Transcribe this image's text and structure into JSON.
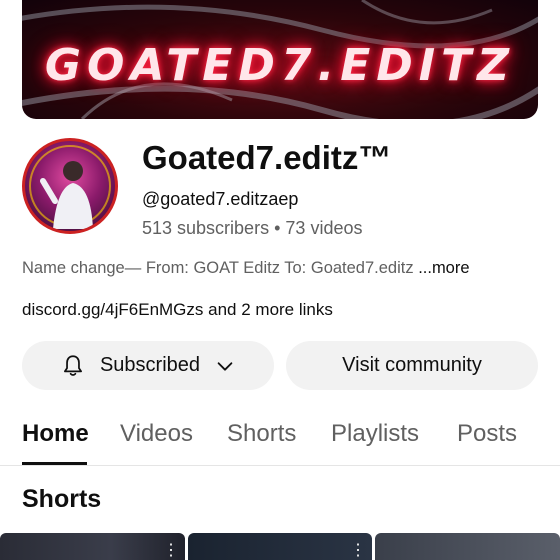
{
  "banner": {
    "title": "GOATED7.EDITZ"
  },
  "channel": {
    "name": "Goated7.editz™",
    "handle": "@goated7.editzaep",
    "subscribers": "513 subscribers",
    "separator": "•",
    "videos": "73 videos",
    "description": "Name change— From: GOAT Editz To: Goated7.editz ",
    "more": "...more",
    "link": "discord.gg/4jF6EnMGzs",
    "more_links": "and 2 more links"
  },
  "buttons": {
    "subscribed": "Subscribed",
    "visit_community": "Visit community"
  },
  "tabs": [
    {
      "label": "Home",
      "active": true
    },
    {
      "label": "Videos",
      "active": false
    },
    {
      "label": "Shorts",
      "active": false
    },
    {
      "label": "Playlists",
      "active": false
    },
    {
      "label": "Posts",
      "active": false
    }
  ],
  "section": {
    "title": "Shorts"
  },
  "colors": {
    "banner_glow": "#ff1436",
    "text_primary": "#0f0f0f",
    "text_secondary": "#606060",
    "button_bg": "#f2f2f2"
  },
  "icons": [
    "bell-icon",
    "chevron-down-icon",
    "more-vert-icon"
  ]
}
